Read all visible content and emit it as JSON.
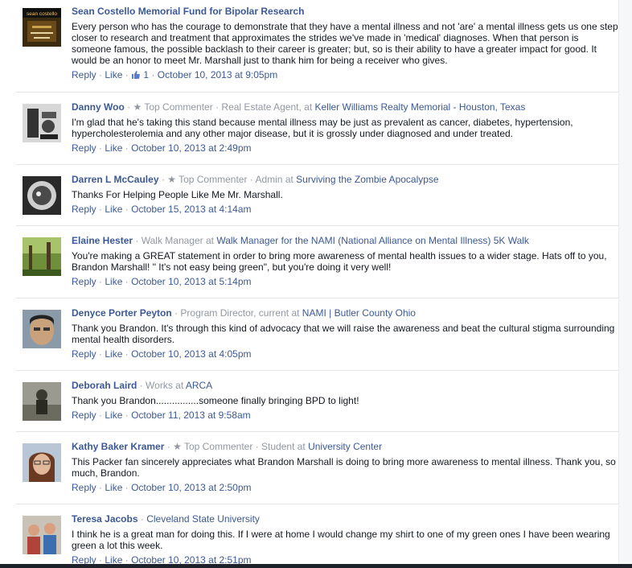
{
  "comments": [
    {
      "author": "Sean Costello Memorial Fund for Bipolar Research",
      "meta": [],
      "text": "Every person who has the courage to demonstrate that they have a mental illness and not 'are' a mental illness gets us one step closer to research and treatment that approximates the strides we've made in 'medical' diagnoses. When that person is someone famous, the possible backlash to their career is greater; but, so is their ability to have a greater impact for good. It would be an honor to meet Mr. Marshall just to thank him for being a receiver who gives.",
      "reply": "Reply",
      "like": "Like",
      "likes": "1",
      "timestamp": "October 10, 2013 at 9:05pm",
      "avatar_caption": "sean costello"
    },
    {
      "author": "Danny Woo",
      "top_commenter": "Top Commenter",
      "meta_prefix": "Real Estate Agent, at ",
      "meta_link": "Keller Williams Realty Memorial - Houston, Texas",
      "text": "I'm glad that he's taking this stand because mental illness may be just as prevalent as cancer, diabetes, hypertension, hypercholesterolemia and any other major disease, but it is grossly under diagnosed and under treated.",
      "reply": "Reply",
      "like": "Like",
      "timestamp": "October 10, 2013 at 2:49pm"
    },
    {
      "author": "Darren L McCauley",
      "top_commenter": "Top Commenter",
      "meta_prefix": "Admin at ",
      "meta_link": "Surviving the Zombie Apocalypse",
      "text": "Thanks For Helping People Like Me Mr. Marshall.",
      "reply": "Reply",
      "like": "Like",
      "timestamp": "October 15, 2013 at 4:14am"
    },
    {
      "author": "Elaine Hester",
      "meta_prefix": "Walk Manager at ",
      "meta_link": "Walk Manager for the NAMI (National Alliance on Mental Illness) 5K Walk",
      "text": "You're making a GREAT statement in order to bring more awareness of mental health issues to a wider stage. Hats off to you, Brandon Marshall! \" It's not easy being green\", but you're doing it very well!",
      "reply": "Reply",
      "like": "Like",
      "timestamp": "October 10, 2013 at 5:14pm"
    },
    {
      "author": "Denyce Porter Peyton",
      "meta_prefix": "Program Director, current at ",
      "meta_link": "NAMI | Butler County Ohio",
      "text": "Thank you Brandon. It's through this kind of advocacy that we will raise the awareness and beat the cultural stigma surrounding mental health disorders.",
      "reply": "Reply",
      "like": "Like",
      "timestamp": "October 10, 2013 at 4:05pm"
    },
    {
      "author": "Deborah Laird",
      "meta_prefix": "Works at ",
      "meta_link": "ARCA",
      "text": "Thank you Brandon................someone finally bringing BPD to light!",
      "reply": "Reply",
      "like": "Like",
      "timestamp": "October 11, 2013 at 9:58am"
    },
    {
      "author": "Kathy Baker Kramer",
      "top_commenter": "Top Commenter",
      "meta_prefix": "Student at ",
      "meta_link": "University Center",
      "text": "This Packer fan sincerely appreciates what Brandon Marshall is doing to bring more awareness to mental illness. Thank you, so much, Brandon.",
      "reply": "Reply",
      "like": "Like",
      "timestamp": "October 10, 2013 at 2:50pm"
    },
    {
      "author": "Teresa Jacobs",
      "meta_prefix": "",
      "meta_link": "Cleveland State University",
      "text": "I think he is a great man for doing this. If I were at home I would change my shirt to one of my green ones I have been wearing green a lot this week.",
      "reply": "Reply",
      "like": "Like",
      "timestamp": "October 10, 2013 at 2:51pm"
    }
  ],
  "separators": {
    "dot": "·",
    "star": "★"
  },
  "colors": {
    "link": "#3b5998",
    "meta": "#9197a3",
    "text": "#141823"
  },
  "icons": {
    "like_count": "thumbs-up-icon",
    "top_commenter": "star-icon"
  }
}
